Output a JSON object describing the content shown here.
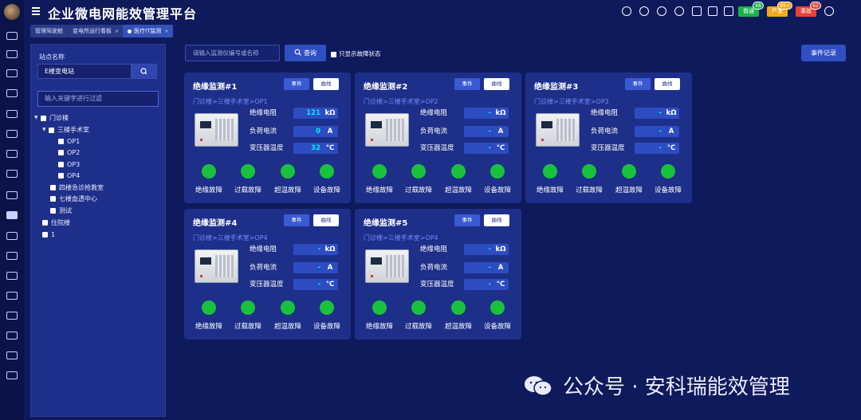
{
  "header": {
    "title": "企业微电网能效管理平台",
    "badges": [
      {
        "label": "普通",
        "count": "48",
        "color": "#19b34a"
      },
      {
        "label": "严重",
        "count": "99+",
        "color": "#f0a91c"
      },
      {
        "label": "事故",
        "count": "62",
        "color": "#e5433a"
      }
    ]
  },
  "tabs": [
    {
      "label": "管理驾驶舱"
    },
    {
      "label": "变电所运行看板",
      "close": "×"
    },
    {
      "label": "医疗IT监测",
      "close": "×"
    }
  ],
  "sidebar": {
    "site_label": "站点名称",
    "site_value": "E楼变电站",
    "filter_placeholder": "输入关键字进行过滤",
    "tree": [
      {
        "label": "门诊楼"
      },
      {
        "label": "三楼手术室"
      },
      {
        "label": "OP1"
      },
      {
        "label": "OP2"
      },
      {
        "label": "OP3"
      },
      {
        "label": "OP4"
      },
      {
        "label": "四楼急诊抢救室"
      },
      {
        "label": "七楼血透中心"
      },
      {
        "label": "测试"
      },
      {
        "label": "住院楼"
      },
      {
        "label": "1"
      }
    ]
  },
  "toolbar": {
    "search_placeholder": "请输入监测仪编号或名称",
    "query_label": "查询",
    "fault_only_label": "只显示故障状态",
    "event_log_label": "事件记录"
  },
  "card_labels": {
    "event": "事件",
    "curve": "曲线",
    "resistance": "绝缘电阻",
    "current": "负荷电流",
    "temperature": "变压器温度",
    "faults": [
      "绝缘故障",
      "过载故障",
      "超温故障",
      "设备故障"
    ]
  },
  "cards": [
    {
      "title": "绝缘监测#1",
      "path": "门诊楼>三楼手术室>OP1",
      "resistance": "121",
      "resistance_unit": "kΩ",
      "current": "0",
      "current_unit": "A",
      "temperature": "32",
      "temperature_unit": "°C"
    },
    {
      "title": "绝缘监测#2",
      "path": "门诊楼>三楼手术室>OP2",
      "resistance": "-",
      "resistance_unit": "kΩ",
      "current": "-",
      "current_unit": "A",
      "temperature": "-",
      "temperature_unit": "°C"
    },
    {
      "title": "绝缘监测#3",
      "path": "门诊楼>三楼手术室>OP3",
      "resistance": "-",
      "resistance_unit": "kΩ",
      "current": "-",
      "current_unit": "A",
      "temperature": "-",
      "temperature_unit": "°C"
    },
    {
      "title": "绝缘监测#4",
      "path": "门诊楼>三楼手术室>OP4",
      "resistance": "-",
      "resistance_unit": "kΩ",
      "current": "-",
      "current_unit": "A",
      "temperature": "-",
      "temperature_unit": "°C"
    },
    {
      "title": "绝缘监测#5",
      "path": "门诊楼>三楼手术室>OP4",
      "resistance": "-",
      "resistance_unit": "kΩ",
      "current": "-",
      "current_unit": "A",
      "temperature": "-",
      "temperature_unit": "°C"
    }
  ],
  "status_color": "#19c23c",
  "watermark": "公众号 · 安科瑞能效管理"
}
